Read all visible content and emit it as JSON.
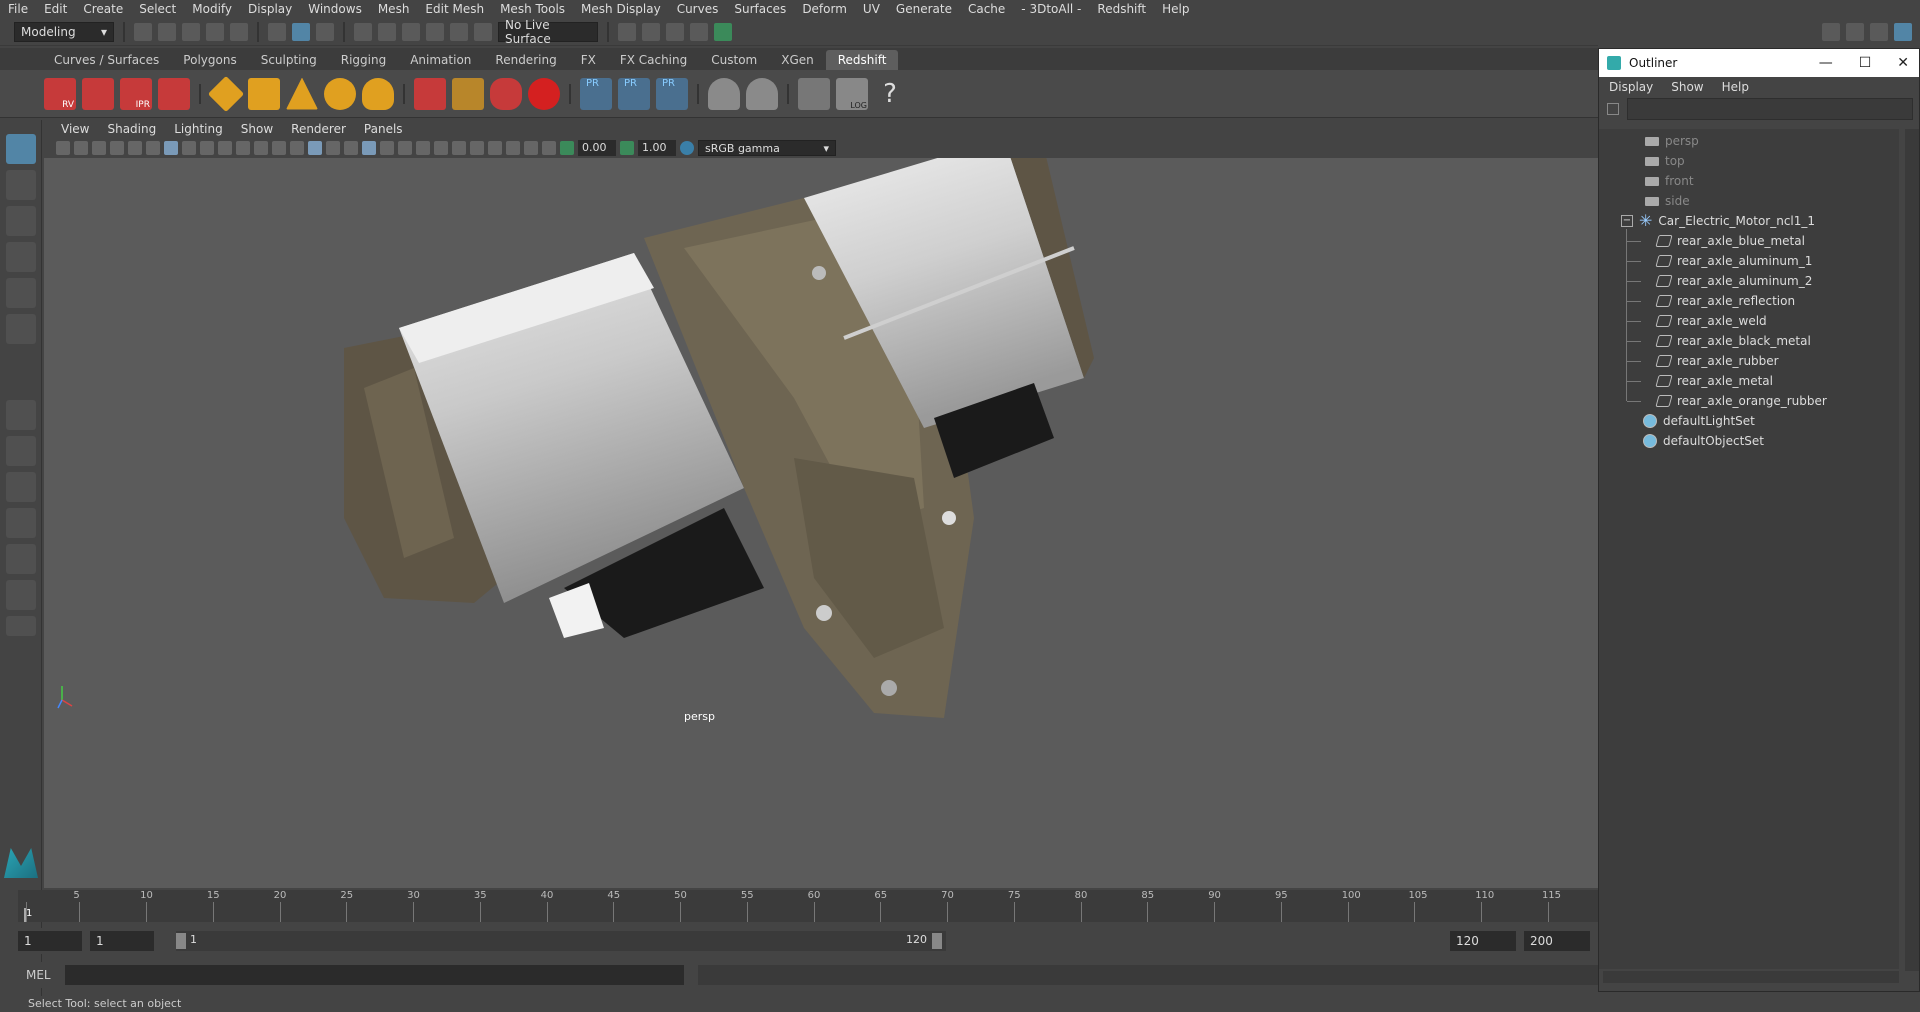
{
  "menubar": [
    "File",
    "Edit",
    "Create",
    "Select",
    "Modify",
    "Display",
    "Windows",
    "Mesh",
    "Edit Mesh",
    "Mesh Tools",
    "Mesh Display",
    "Curves",
    "Surfaces",
    "Deform",
    "UV",
    "Generate",
    "Cache",
    "- 3DtoAll -",
    "Redshift",
    "Help"
  ],
  "status": {
    "mode": "Modeling",
    "live_surface": "No Live Surface"
  },
  "shelf_tabs": [
    "Curves / Surfaces",
    "Polygons",
    "Sculpting",
    "Rigging",
    "Animation",
    "Rendering",
    "FX",
    "FX Caching",
    "Custom",
    "XGen",
    "Redshift"
  ],
  "active_shelf": "Redshift",
  "shelf_labels": {
    "rv": "RV",
    "ipr": "IPR",
    "pr1": "PR",
    "pr2": "PR",
    "pr3": "PR",
    "log": "LOG",
    "help": "?"
  },
  "panel_menu": [
    "View",
    "Shading",
    "Lighting",
    "Show",
    "Renderer",
    "Panels"
  ],
  "panel_toolbar": {
    "exposure": "0.00",
    "gamma": "1.00",
    "colorspace": "sRGB gamma"
  },
  "viewport": {
    "camera_label": "persp"
  },
  "timeline": {
    "ticks": [
      "1",
      "5",
      "10",
      "15",
      "20",
      "25",
      "30",
      "35",
      "40",
      "45",
      "50",
      "55",
      "60",
      "65",
      "70",
      "75",
      "80",
      "85",
      "90",
      "95",
      "100",
      "105",
      "110",
      "115"
    ],
    "current_frame": "1"
  },
  "range": {
    "start": "1",
    "current": "1",
    "range_start": "1",
    "range_end": "120",
    "end": "120",
    "max": "200"
  },
  "mel": {
    "label": "MEL"
  },
  "help_line": "Select Tool: select an object",
  "outliner": {
    "title": "Outliner",
    "menu": [
      "Display",
      "Show",
      "Help"
    ],
    "cameras": [
      "persp",
      "top",
      "front",
      "side"
    ],
    "group": "Car_Electric_Motor_ncl1_1",
    "children": [
      "rear_axle_blue_metal",
      "rear_axle_aluminum_1",
      "rear_axle_aluminum_2",
      "rear_axle_reflection",
      "rear_axle_weld",
      "rear_axle_black_metal",
      "rear_axle_rubber",
      "rear_axle_metal",
      "rear_axle_orange_rubber"
    ],
    "sets": [
      "defaultLightSet",
      "defaultObjectSet"
    ]
  },
  "colors": {
    "accent": "#5285a6",
    "redshift_red": "#d9363e",
    "active_tab": "#5e5e5e"
  }
}
